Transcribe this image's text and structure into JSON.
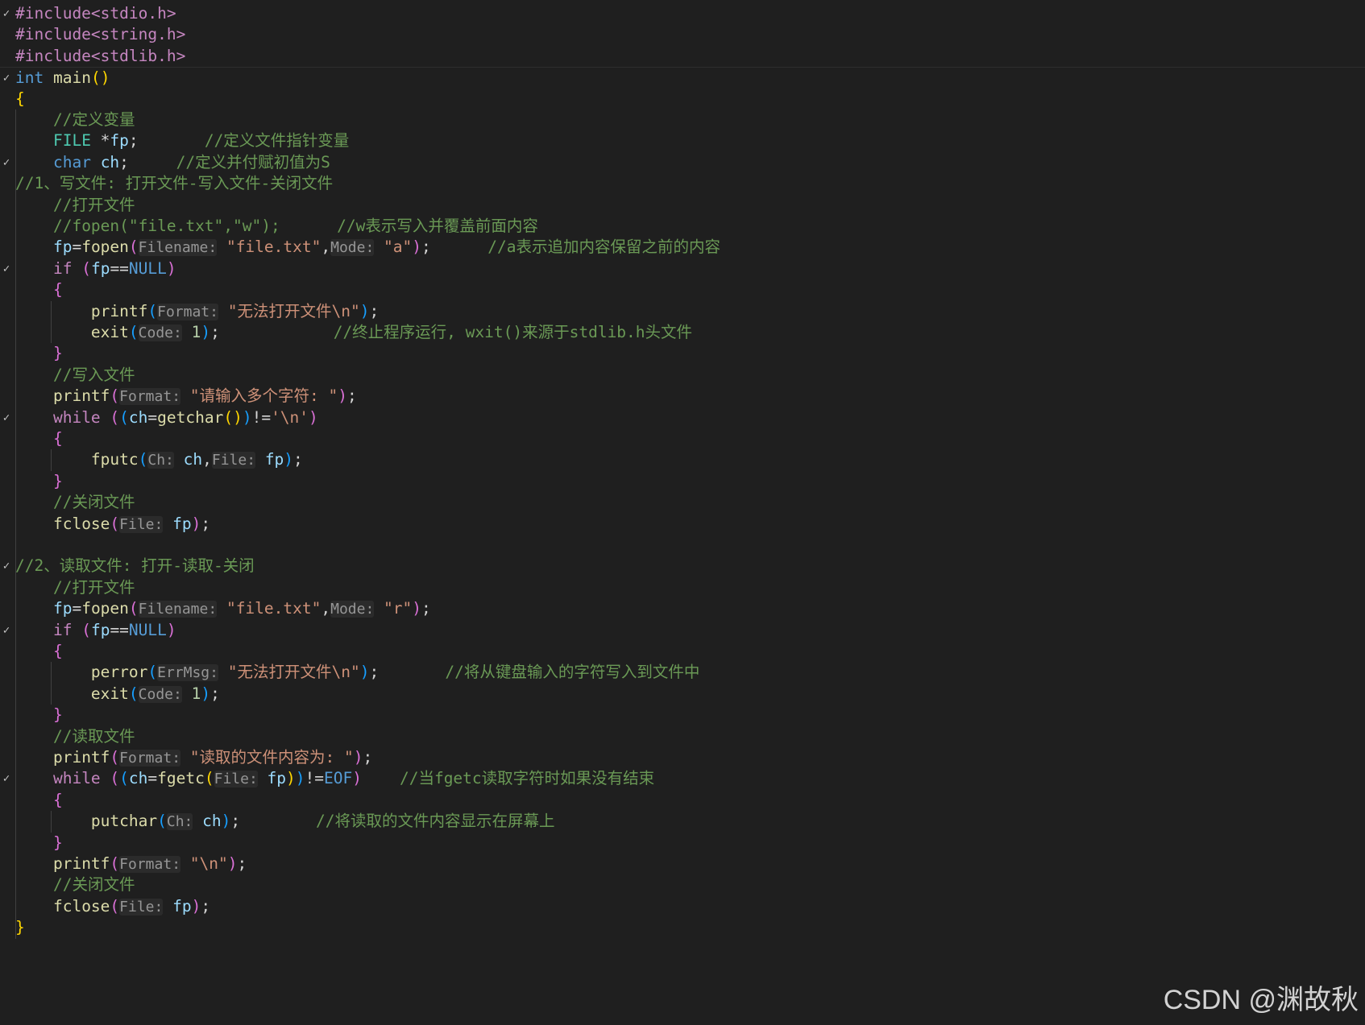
{
  "editor": {
    "language": "c",
    "colors": {
      "background": "#1f1f1f",
      "keyword": "#569cd6",
      "control": "#c586c0",
      "function": "#dcdcaa",
      "variable": "#9cdcfe",
      "string": "#ce9178",
      "comment": "#6a9955",
      "number": "#b5cea8"
    },
    "lines": [
      {
        "fold": true,
        "tokens": [
          [
            "pp",
            "#include<stdio.h>"
          ]
        ]
      },
      {
        "fold": false,
        "tokens": [
          [
            "pp",
            "#include<string.h>"
          ]
        ]
      },
      {
        "fold": false,
        "tokens": [
          [
            "pp",
            "#include<stdlib.h>"
          ]
        ]
      },
      {
        "fold": true,
        "tokens": [
          [
            "kw",
            "int"
          ],
          [
            "op",
            " "
          ],
          [
            "fn",
            "main"
          ],
          [
            "b1",
            "()"
          ]
        ]
      },
      {
        "fold": false,
        "tokens": [
          [
            "b1",
            "{"
          ]
        ]
      },
      {
        "fold": false,
        "tokens": [
          [
            "op",
            "    "
          ],
          [
            "cmt",
            "//定义变量"
          ]
        ]
      },
      {
        "fold": false,
        "tokens": [
          [
            "op",
            "    "
          ],
          [
            "typ",
            "FILE"
          ],
          [
            "op",
            " *"
          ],
          [
            "var",
            "fp"
          ],
          [
            "op",
            ";       "
          ],
          [
            "cmt",
            "//定义文件指针变量"
          ]
        ]
      },
      {
        "fold": true,
        "tokens": [
          [
            "op",
            "    "
          ],
          [
            "kw",
            "char"
          ],
          [
            "op",
            " "
          ],
          [
            "var",
            "ch"
          ],
          [
            "op",
            ";     "
          ],
          [
            "cmt",
            "//定义并付赋初值为S"
          ]
        ]
      },
      {
        "fold": false,
        "tokens": [
          [
            "cmt",
            "//1、写文件: 打开文件-写入文件-关闭文件"
          ]
        ]
      },
      {
        "fold": false,
        "tokens": [
          [
            "op",
            "    "
          ],
          [
            "cmt",
            "//打开文件"
          ]
        ]
      },
      {
        "fold": false,
        "tokens": [
          [
            "op",
            "    "
          ],
          [
            "cmt",
            "//fopen(\"file.txt\",\"w\");      //w表示写入并覆盖前面内容"
          ]
        ]
      },
      {
        "fold": false,
        "tokens": [
          [
            "op",
            "    "
          ],
          [
            "var",
            "fp"
          ],
          [
            "op",
            "="
          ],
          [
            "fn",
            "fopen"
          ],
          [
            "b2",
            "("
          ],
          [
            "hint",
            "Filename:"
          ],
          [
            "op",
            " "
          ],
          [
            "str",
            "\"file.txt\""
          ],
          [
            "op",
            ","
          ],
          [
            "hint",
            "Mode:"
          ],
          [
            "op",
            " "
          ],
          [
            "str",
            "\"a\""
          ],
          [
            "b2",
            ")"
          ],
          [
            "op",
            ";      "
          ],
          [
            "cmt",
            "//a表示追加内容保留之前的内容"
          ]
        ]
      },
      {
        "fold": true,
        "tokens": [
          [
            "op",
            "    "
          ],
          [
            "ctl",
            "if"
          ],
          [
            "op",
            " "
          ],
          [
            "b2",
            "("
          ],
          [
            "var",
            "fp"
          ],
          [
            "op",
            "=="
          ],
          [
            "mac",
            "NULL"
          ],
          [
            "b2",
            ")"
          ]
        ]
      },
      {
        "fold": false,
        "tokens": [
          [
            "op",
            "    "
          ],
          [
            "b2",
            "{"
          ]
        ]
      },
      {
        "fold": false,
        "tokens": [
          [
            "op",
            "        "
          ],
          [
            "fn",
            "printf"
          ],
          [
            "b3",
            "("
          ],
          [
            "hint",
            "Format:"
          ],
          [
            "op",
            " "
          ],
          [
            "str",
            "\"无法打开文件\\n\""
          ],
          [
            "b3",
            ")"
          ],
          [
            "op",
            ";"
          ]
        ]
      },
      {
        "fold": false,
        "tokens": [
          [
            "op",
            "        "
          ],
          [
            "fn",
            "exit"
          ],
          [
            "b3",
            "("
          ],
          [
            "hint",
            "Code:"
          ],
          [
            "op",
            " "
          ],
          [
            "num",
            "1"
          ],
          [
            "b3",
            ")"
          ],
          [
            "op",
            ";            "
          ],
          [
            "cmt",
            "//终止程序运行, wxit()来源于stdlib.h头文件"
          ]
        ]
      },
      {
        "fold": false,
        "tokens": [
          [
            "op",
            "    "
          ],
          [
            "b2",
            "}"
          ]
        ]
      },
      {
        "fold": false,
        "tokens": [
          [
            "op",
            "    "
          ],
          [
            "cmt",
            "//写入文件"
          ]
        ]
      },
      {
        "fold": false,
        "tokens": [
          [
            "op",
            "    "
          ],
          [
            "fn",
            "printf"
          ],
          [
            "b2",
            "("
          ],
          [
            "hint",
            "Format:"
          ],
          [
            "op",
            " "
          ],
          [
            "str",
            "\"请输入多个字符: \""
          ],
          [
            "b2",
            ")"
          ],
          [
            "op",
            ";"
          ]
        ]
      },
      {
        "fold": true,
        "tokens": [
          [
            "op",
            "    "
          ],
          [
            "ctl",
            "while"
          ],
          [
            "op",
            " "
          ],
          [
            "b2",
            "("
          ],
          [
            "b3",
            "("
          ],
          [
            "var",
            "ch"
          ],
          [
            "op",
            "="
          ],
          [
            "fn",
            "getchar"
          ],
          [
            "b1",
            "()"
          ],
          [
            "b3",
            ")"
          ],
          [
            "op",
            "!="
          ],
          [
            "str",
            "'\\n'"
          ],
          [
            "b2",
            ")"
          ]
        ]
      },
      {
        "fold": false,
        "tokens": [
          [
            "op",
            "    "
          ],
          [
            "b2",
            "{"
          ]
        ]
      },
      {
        "fold": false,
        "tokens": [
          [
            "op",
            "        "
          ],
          [
            "fn",
            "fputc"
          ],
          [
            "b3",
            "("
          ],
          [
            "hint",
            "Ch:"
          ],
          [
            "op",
            " "
          ],
          [
            "var",
            "ch"
          ],
          [
            "op",
            ","
          ],
          [
            "hint",
            "File:"
          ],
          [
            "op",
            " "
          ],
          [
            "var",
            "fp"
          ],
          [
            "b3",
            ")"
          ],
          [
            "op",
            ";"
          ]
        ]
      },
      {
        "fold": false,
        "tokens": [
          [
            "op",
            "    "
          ],
          [
            "b2",
            "}"
          ]
        ]
      },
      {
        "fold": false,
        "tokens": [
          [
            "op",
            "    "
          ],
          [
            "cmt",
            "//关闭文件"
          ]
        ]
      },
      {
        "fold": false,
        "tokens": [
          [
            "op",
            "    "
          ],
          [
            "fn",
            "fclose"
          ],
          [
            "b2",
            "("
          ],
          [
            "hint",
            "File:"
          ],
          [
            "op",
            " "
          ],
          [
            "var",
            "fp"
          ],
          [
            "b2",
            ")"
          ],
          [
            "op",
            ";"
          ]
        ]
      },
      {
        "fold": false,
        "tokens": [
          [
            "op",
            ""
          ]
        ]
      },
      {
        "fold": true,
        "tokens": [
          [
            "cmt",
            "//2、读取文件: 打开-读取-关闭"
          ]
        ]
      },
      {
        "fold": false,
        "tokens": [
          [
            "op",
            "    "
          ],
          [
            "cmt",
            "//打开文件"
          ]
        ]
      },
      {
        "fold": false,
        "tokens": [
          [
            "op",
            "    "
          ],
          [
            "var",
            "fp"
          ],
          [
            "op",
            "="
          ],
          [
            "fn",
            "fopen"
          ],
          [
            "b2",
            "("
          ],
          [
            "hint",
            "Filename:"
          ],
          [
            "op",
            " "
          ],
          [
            "str",
            "\"file.txt\""
          ],
          [
            "op",
            ","
          ],
          [
            "hint",
            "Mode:"
          ],
          [
            "op",
            " "
          ],
          [
            "str",
            "\"r\""
          ],
          [
            "b2",
            ")"
          ],
          [
            "op",
            ";"
          ]
        ]
      },
      {
        "fold": true,
        "tokens": [
          [
            "op",
            "    "
          ],
          [
            "ctl",
            "if"
          ],
          [
            "op",
            " "
          ],
          [
            "b2",
            "("
          ],
          [
            "var",
            "fp"
          ],
          [
            "op",
            "=="
          ],
          [
            "mac",
            "NULL"
          ],
          [
            "b2",
            ")"
          ]
        ]
      },
      {
        "fold": false,
        "tokens": [
          [
            "op",
            "    "
          ],
          [
            "b2",
            "{"
          ]
        ]
      },
      {
        "fold": false,
        "tokens": [
          [
            "op",
            "        "
          ],
          [
            "fn",
            "perror"
          ],
          [
            "b3",
            "("
          ],
          [
            "hint",
            "ErrMsg:"
          ],
          [
            "op",
            " "
          ],
          [
            "str",
            "\"无法打开文件\\n\""
          ],
          [
            "b3",
            ")"
          ],
          [
            "op",
            ";       "
          ],
          [
            "cmt",
            "//将从键盘输入的字符写入到文件中"
          ]
        ]
      },
      {
        "fold": false,
        "tokens": [
          [
            "op",
            "        "
          ],
          [
            "fn",
            "exit"
          ],
          [
            "b3",
            "("
          ],
          [
            "hint",
            "Code:"
          ],
          [
            "op",
            " "
          ],
          [
            "num",
            "1"
          ],
          [
            "b3",
            ")"
          ],
          [
            "op",
            ";"
          ]
        ]
      },
      {
        "fold": false,
        "tokens": [
          [
            "op",
            "    "
          ],
          [
            "b2",
            "}"
          ]
        ]
      },
      {
        "fold": false,
        "tokens": [
          [
            "op",
            "    "
          ],
          [
            "cmt",
            "//读取文件"
          ]
        ]
      },
      {
        "fold": false,
        "tokens": [
          [
            "op",
            "    "
          ],
          [
            "fn",
            "printf"
          ],
          [
            "b2",
            "("
          ],
          [
            "hint",
            "Format:"
          ],
          [
            "op",
            " "
          ],
          [
            "str",
            "\"读取的文件内容为: \""
          ],
          [
            "b2",
            ")"
          ],
          [
            "op",
            ";"
          ]
        ]
      },
      {
        "fold": true,
        "tokens": [
          [
            "op",
            "    "
          ],
          [
            "ctl",
            "while"
          ],
          [
            "op",
            " "
          ],
          [
            "b2",
            "("
          ],
          [
            "b3",
            "("
          ],
          [
            "var",
            "ch"
          ],
          [
            "op",
            "="
          ],
          [
            "fn",
            "fgetc"
          ],
          [
            "b1",
            "("
          ],
          [
            "hint",
            "File:"
          ],
          [
            "op",
            " "
          ],
          [
            "var",
            "fp"
          ],
          [
            "b1",
            ")"
          ],
          [
            "b3",
            ")"
          ],
          [
            "op",
            "!="
          ],
          [
            "mac",
            "EOF"
          ],
          [
            "b2",
            ")"
          ],
          [
            "op",
            "    "
          ],
          [
            "cmt",
            "//当fgetc读取字符时如果没有结束"
          ]
        ]
      },
      {
        "fold": false,
        "tokens": [
          [
            "op",
            "    "
          ],
          [
            "b2",
            "{"
          ]
        ]
      },
      {
        "fold": false,
        "tokens": [
          [
            "op",
            "        "
          ],
          [
            "fn",
            "putchar"
          ],
          [
            "b3",
            "("
          ],
          [
            "hint",
            "Ch:"
          ],
          [
            "op",
            " "
          ],
          [
            "var",
            "ch"
          ],
          [
            "b3",
            ")"
          ],
          [
            "op",
            ";        "
          ],
          [
            "cmt",
            "//将读取的文件内容显示在屏幕上"
          ]
        ]
      },
      {
        "fold": false,
        "tokens": [
          [
            "op",
            "    "
          ],
          [
            "b2",
            "}"
          ]
        ]
      },
      {
        "fold": false,
        "tokens": [
          [
            "op",
            "    "
          ],
          [
            "fn",
            "printf"
          ],
          [
            "b2",
            "("
          ],
          [
            "hint",
            "Format:"
          ],
          [
            "op",
            " "
          ],
          [
            "str",
            "\"\\n\""
          ],
          [
            "b2",
            ")"
          ],
          [
            "op",
            ";"
          ]
        ]
      },
      {
        "fold": false,
        "tokens": [
          [
            "op",
            "    "
          ],
          [
            "cmt",
            "//关闭文件"
          ]
        ]
      },
      {
        "fold": false,
        "tokens": [
          [
            "op",
            "    "
          ],
          [
            "fn",
            "fclose"
          ],
          [
            "b2",
            "("
          ],
          [
            "hint",
            "File:"
          ],
          [
            "op",
            " "
          ],
          [
            "var",
            "fp"
          ],
          [
            "b2",
            ")"
          ],
          [
            "op",
            ";"
          ]
        ]
      },
      {
        "fold": false,
        "tokens": [
          [
            "b1",
            "}"
          ]
        ]
      }
    ]
  },
  "watermark": "CSDN @渊故秋",
  "icons": {
    "fold": "chevron-down-icon"
  }
}
